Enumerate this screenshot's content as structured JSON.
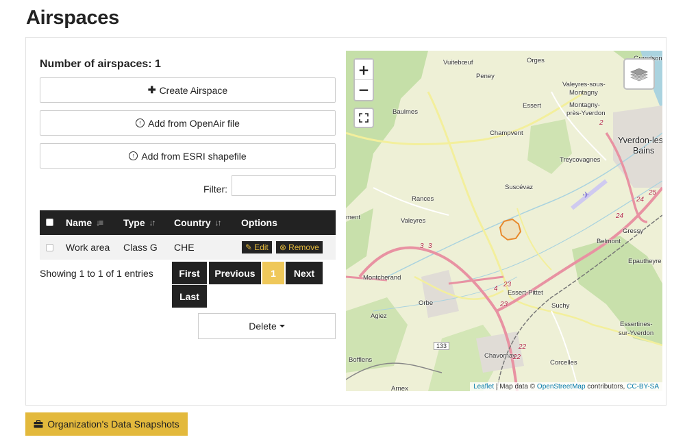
{
  "page": {
    "title": "Airspaces"
  },
  "summary": {
    "count_label": "Number of airspaces: 1"
  },
  "actions": {
    "create_label": "Create Airspace",
    "openair_label": "Add from OpenAir file",
    "esri_label": "Add from ESRI shapefile"
  },
  "filter": {
    "label": "Filter:",
    "value": "",
    "placeholder": ""
  },
  "table": {
    "columns": [
      "Name",
      "Type",
      "Country",
      "Options"
    ],
    "rows": [
      {
        "name": "Work area",
        "type": "Class G",
        "country": "CHE",
        "edit_label": "Edit",
        "remove_label": "Remove"
      }
    ]
  },
  "pagination": {
    "info": "Showing 1 to 1 of 1 entries",
    "first": "First",
    "previous": "Previous",
    "current": "1",
    "next": "Next",
    "last": "Last"
  },
  "bulk": {
    "delete_label": "Delete"
  },
  "map": {
    "zoom_in": "+",
    "zoom_out": "−",
    "places": [
      "Vuitebœuf",
      "Orges",
      "Grandson",
      "Peney",
      "Valeyres-sous-",
      "Montagny",
      "Montagny-",
      "près-Yverdon",
      "Essert",
      "Baulmes",
      "Champvent",
      "Yverdon-les-",
      "Bains",
      "Treycovagnes",
      "Suscévaz",
      "Rances",
      "Valeyres",
      "ment",
      "Gressy",
      "Belmont",
      "Epautheyre",
      "Montcherand",
      "Essert-Pittet",
      "Orbe",
      "Suchy",
      "Agiez",
      "Essertines-",
      "sur-Yverdon",
      "Bofflens",
      "Chavornay",
      "Corcelles",
      "Arnex"
    ],
    "road_numbers": [
      "2",
      "24",
      "24",
      "25",
      "3",
      "3",
      "4",
      "23",
      "23",
      "22",
      "22",
      "133"
    ],
    "attribution": {
      "leaflet": "Leaflet",
      "sep": " | Map data © ",
      "osm": "OpenStreetMap",
      "contributors": " contributors, ",
      "license": "CC-BY-SA"
    }
  },
  "footer": {
    "snapshots_label": "Organization's Data Snapshots"
  },
  "colors": {
    "accent": "#e3b93c",
    "dark": "#222222",
    "active_page": "#efc85a",
    "airspace": "#e8892c"
  }
}
